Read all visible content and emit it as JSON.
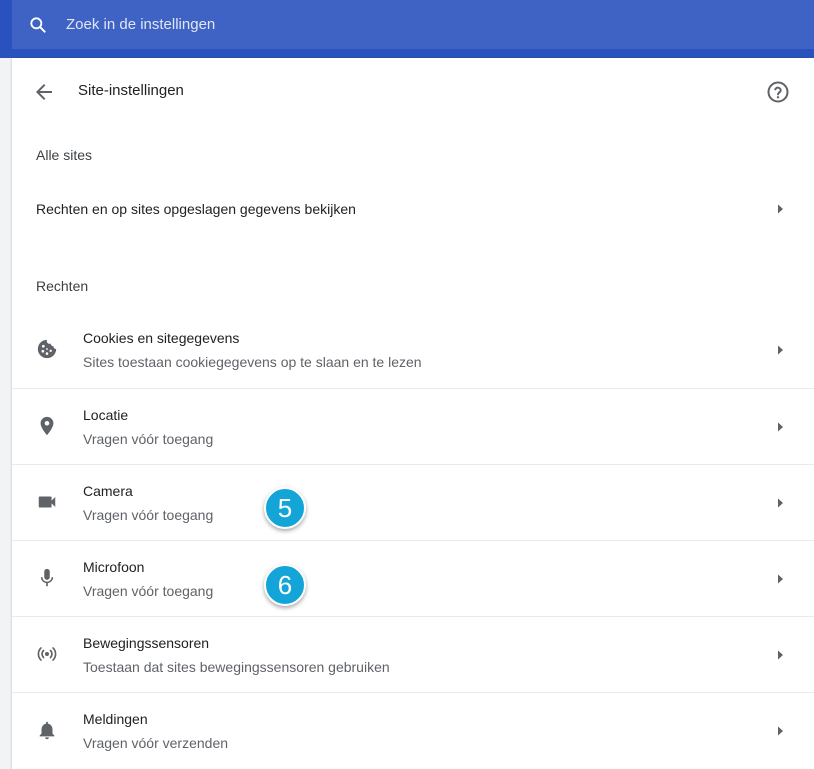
{
  "search": {
    "placeholder": "Zoek in de instellingen",
    "value": ""
  },
  "header": {
    "title": "Site-instellingen"
  },
  "all_sites": {
    "section_label": "Alle sites",
    "row_label": "Rechten en op sites opgeslagen gegevens bekijken"
  },
  "permissions": {
    "section_label": "Rechten",
    "items": [
      {
        "icon": "cookie-icon",
        "title": "Cookies en sitegegevens",
        "subtitle": "Sites toestaan cookiegegevens op te slaan en te lezen"
      },
      {
        "icon": "location-pin-icon",
        "title": "Locatie",
        "subtitle": "Vragen vóór toegang"
      },
      {
        "icon": "videocam-icon",
        "title": "Camera",
        "subtitle": "Vragen vóór toegang"
      },
      {
        "icon": "microphone-icon",
        "title": "Microfoon",
        "subtitle": "Vragen vóór toegang"
      },
      {
        "icon": "sensors-icon",
        "title": "Bewegingssensoren",
        "subtitle": "Toestaan dat sites bewegingssensoren gebruiken"
      },
      {
        "icon": "bell-icon",
        "title": "Meldingen",
        "subtitle": "Vragen vóór verzenden"
      }
    ]
  },
  "annotations": {
    "badge_camera": "5",
    "badge_microphone": "6"
  },
  "colors": {
    "topbar": "#2a52be",
    "search_field": "#3e63c4",
    "badge": "#13a4d8",
    "icon": "#5f6368"
  }
}
